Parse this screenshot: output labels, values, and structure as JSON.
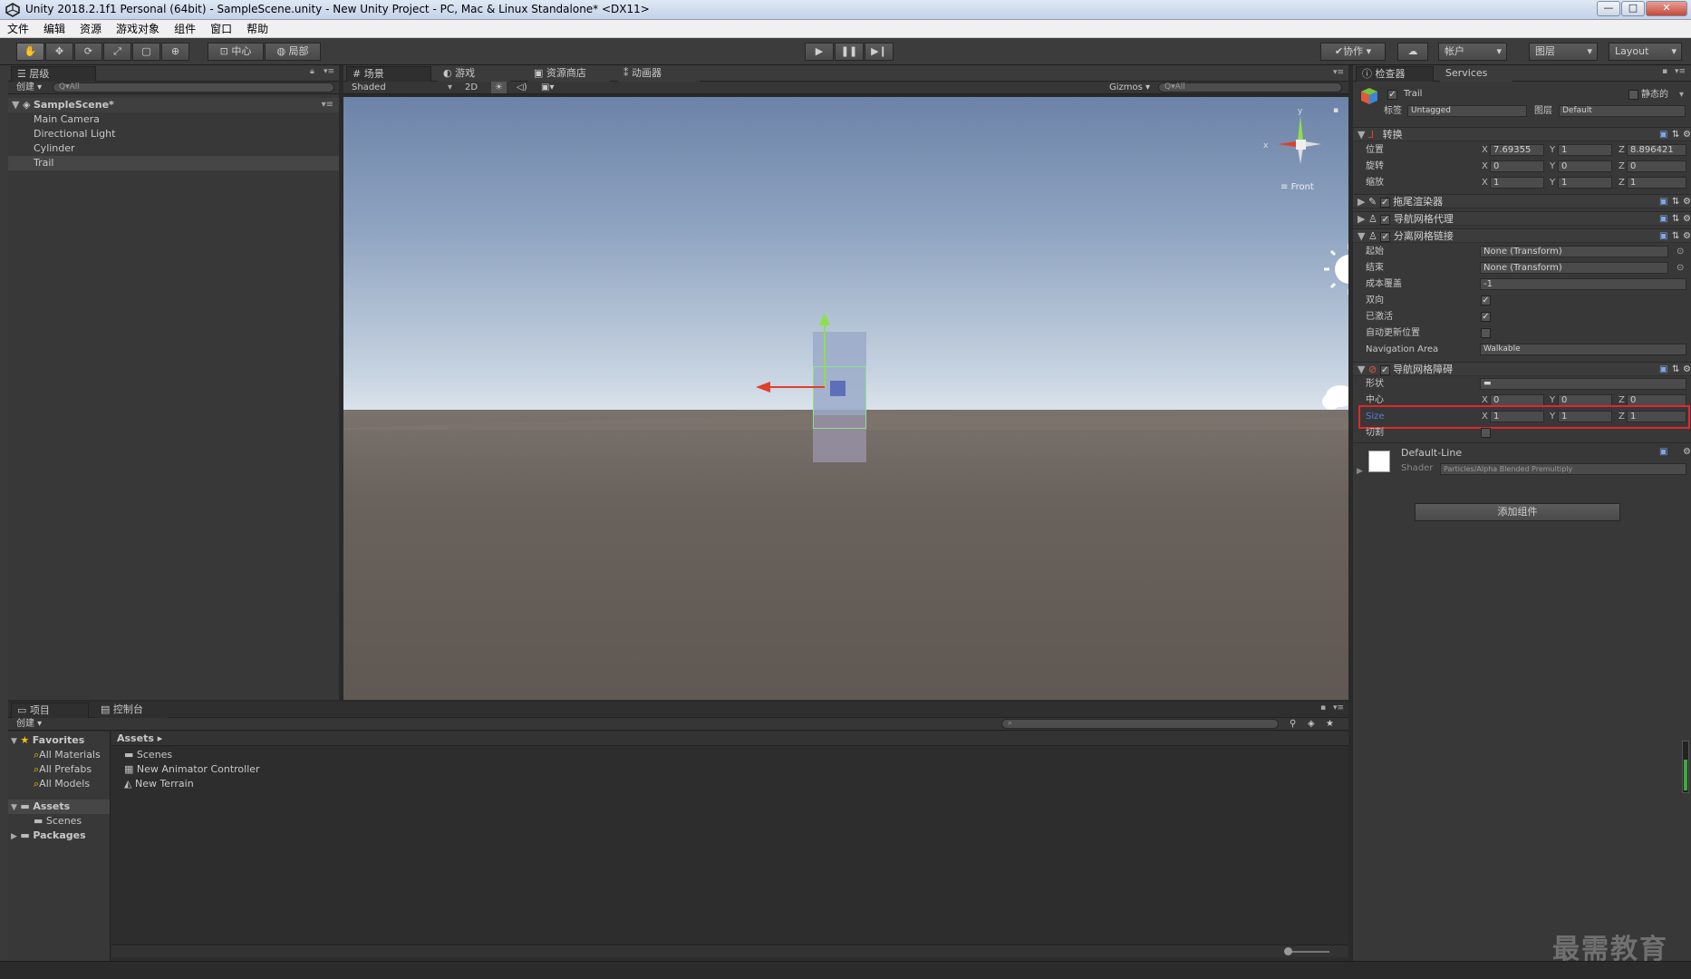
{
  "window": {
    "title": "Unity 2018.2.1f1 Personal (64bit) - SampleScene.unity - New Unity Project - PC, Mac & Linux Standalone* <DX11>",
    "controls": {
      "minimize": "—",
      "maximize": "□",
      "close": "✕"
    }
  },
  "menu": [
    "文件",
    "编辑",
    "资源",
    "游戏对象",
    "组件",
    "窗口",
    "帮助"
  ],
  "toolbar": {
    "pivot": "中心",
    "space": "局部",
    "collab": "协作",
    "account": "帐户",
    "layers": "图层",
    "layout": "Layout"
  },
  "hierarchy": {
    "tab": "层级",
    "create": "创建",
    "search_placeholder": "Q▾All",
    "scene": "SampleScene*",
    "items": [
      "Main Camera",
      "Directional Light",
      "Cylinder",
      "Trail"
    ]
  },
  "scene_tabs": [
    "场景",
    "游戏",
    "资源商店",
    "动画器"
  ],
  "scene_bar": {
    "shading": "Shaded",
    "mode2d": "2D",
    "gizmos": "Gizmos",
    "search_placeholder": "Q▾All"
  },
  "gizmo": {
    "x": "x",
    "y": "y",
    "view": "Front"
  },
  "inspector": {
    "tab": "检查器",
    "services_tab": "Services",
    "object_name": "Trail",
    "static": "静态的",
    "tag_label": "标签",
    "tag": "Untagged",
    "layer_label": "图层",
    "layer": "Default",
    "transform": {
      "title": "转换",
      "position_label": "位置",
      "position": {
        "x": "7.69355",
        "y": "1",
        "z": "8.896421"
      },
      "rotation_label": "旋转",
      "rotation": {
        "x": "0",
        "y": "0",
        "z": "0"
      },
      "scale_label": "缩放",
      "scale": {
        "x": "1",
        "y": "1",
        "z": "1"
      }
    },
    "trail_renderer": "拖尾渲染器",
    "nav_agent": "导航网格代理",
    "offmesh_link": {
      "title": "分离网格链接",
      "start_label": "起始",
      "start": "None (Transform)",
      "end_label": "结束",
      "end": "None (Transform)",
      "cost_label": "成本覆盖",
      "cost": "-1",
      "bidir_label": "双向",
      "activated_label": "已激活",
      "autoupdate_label": "自动更新位置",
      "navarea_label": "Navigation Area",
      "navarea": "Walkable"
    },
    "obstacle": {
      "title": "导航网格障碍",
      "shape_label": "形状",
      "center_label": "中心",
      "center": {
        "x": "0",
        "y": "0",
        "z": "0"
      },
      "size_label": "Size",
      "size": {
        "x": "1",
        "y": "1",
        "z": "1"
      },
      "carve_label": "切割"
    },
    "material": {
      "name": "Default-Line",
      "shader_label": "Shader",
      "shader": "Particles/Alpha Blended Premultiply"
    },
    "add_component": "添加组件",
    "axes": {
      "x": "X",
      "y": "Y",
      "z": "Z"
    },
    "check": "✓"
  },
  "project": {
    "tab": "项目",
    "console_tab": "控制台",
    "create": "创建",
    "favorites": "Favorites",
    "fav_items": [
      "All Materials",
      "All Prefabs",
      "All Models"
    ],
    "assets_root": "Assets",
    "assets_children": [
      "Scenes"
    ],
    "packages": "Packages",
    "breadcrumb": "Assets ▸",
    "files": [
      "Scenes",
      "New Animator Controller",
      "New Terrain"
    ]
  },
  "watermark": "最需教育",
  "colors": {
    "highlight_box": "#e0282c",
    "selected_blue": "#3d6bc4",
    "size_label": "#4f7fe0"
  }
}
